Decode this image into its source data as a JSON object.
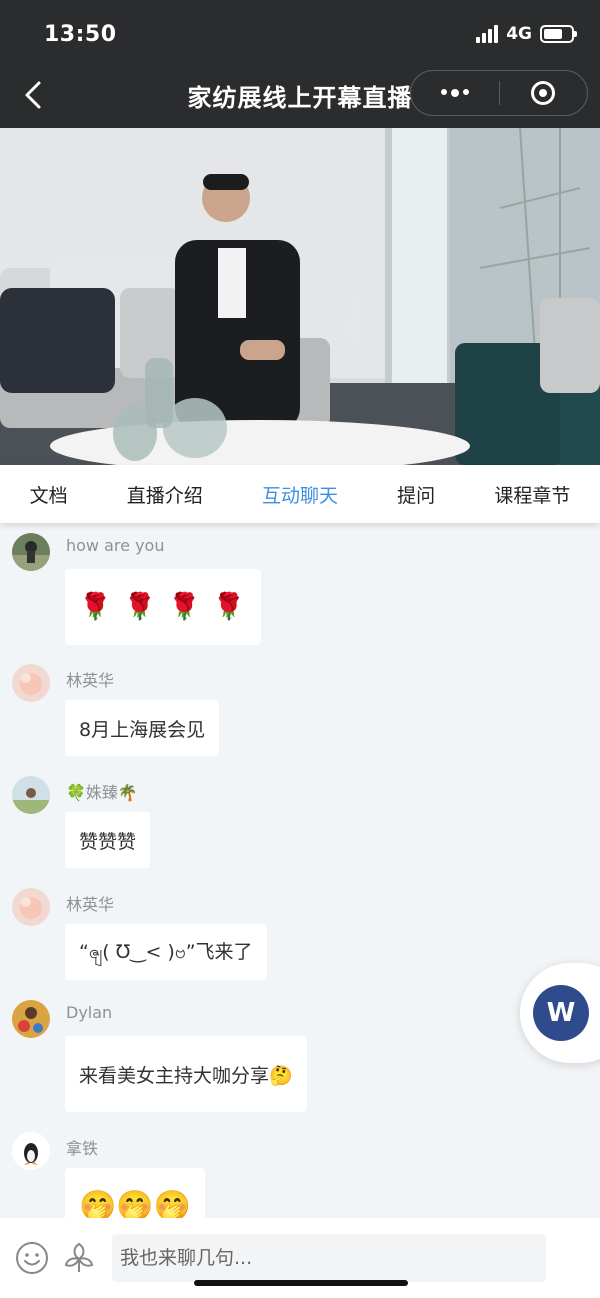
{
  "status_bar": {
    "time": "13:50",
    "network": "4G"
  },
  "nav": {
    "title": "家纺展线上开幕直播"
  },
  "tabs": [
    {
      "label": "文档"
    },
    {
      "label": "直播介绍"
    },
    {
      "label": "互动聊天"
    },
    {
      "label": "提问"
    },
    {
      "label": "课程章节"
    }
  ],
  "active_tab": "互动聊天",
  "messages": [
    {
      "user": "how are you",
      "text": "🌹 🌹 🌹 🌹"
    },
    {
      "user": "林英华",
      "text": "8月上海展会见"
    },
    {
      "user": "🍀姝臻🌴",
      "text": "赞赞赞"
    },
    {
      "user": "林英华",
      "text": "“ၛ( ℧‿< )ဗ”飞来了"
    },
    {
      "user": "Dylan",
      "text": "来看美女主持大咖分享🤔"
    },
    {
      "user": "拿铁",
      "text": "🤭🤭🤭"
    }
  ],
  "floating_button": {
    "label": "W"
  },
  "chat_input": {
    "placeholder": "我也来聊几句..."
  },
  "colors": {
    "accent": "#3f8ee0",
    "top_bar": "#2b2c2e",
    "chat_bg": "#f2f5f7",
    "fab": "#2f4b8e"
  }
}
